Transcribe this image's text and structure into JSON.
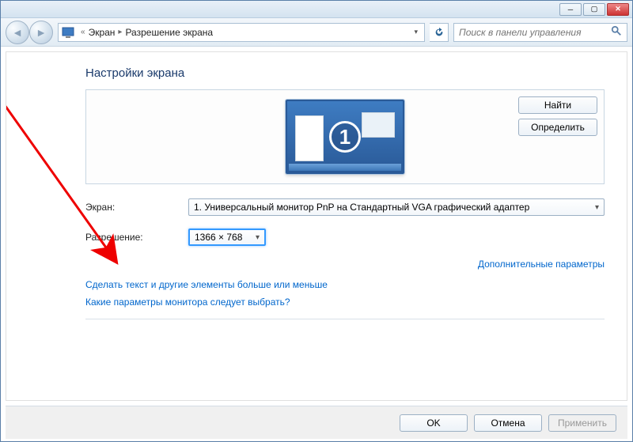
{
  "breadcrumb": {
    "item1": "Экран",
    "item2": "Разрешение экрана"
  },
  "search": {
    "placeholder": "Поиск в панели управления"
  },
  "heading": "Настройки экрана",
  "buttons": {
    "find": "Найти",
    "detect": "Определить",
    "ok": "OK",
    "cancel": "Отмена",
    "apply": "Применить"
  },
  "monitor_number": "1",
  "labels": {
    "display": "Экран:",
    "resolution": "Разрешение:"
  },
  "values": {
    "display": "1. Универсальный монитор PnP на Стандартный VGA графический адаптер",
    "resolution": "1366 × 768"
  },
  "links": {
    "advanced": "Дополнительные параметры",
    "text_size": "Сделать текст и другие элементы больше или меньше",
    "which_settings": "Какие параметры монитора следует выбрать?"
  }
}
